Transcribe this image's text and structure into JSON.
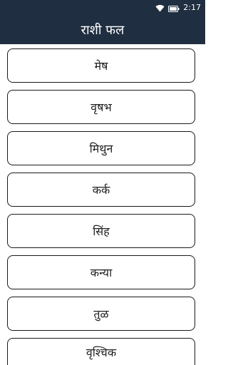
{
  "status_bar": {
    "wifi_icon": "wifi-icon",
    "battery_icon": "battery-icon",
    "time": "2:17"
  },
  "app_bar": {
    "title": "राशी फल"
  },
  "rashi_list": [
    {
      "label": "मेष"
    },
    {
      "label": "वृषभ"
    },
    {
      "label": "मिथुन"
    },
    {
      "label": "कर्क"
    },
    {
      "label": "सिंह"
    },
    {
      "label": "कन्या"
    },
    {
      "label": "तुळ"
    },
    {
      "label": "वृश्चिक"
    }
  ],
  "colors": {
    "app_bar_bg": "#1f2e40",
    "item_border": "#1a1a1a",
    "page_bg": "#ffffff"
  }
}
